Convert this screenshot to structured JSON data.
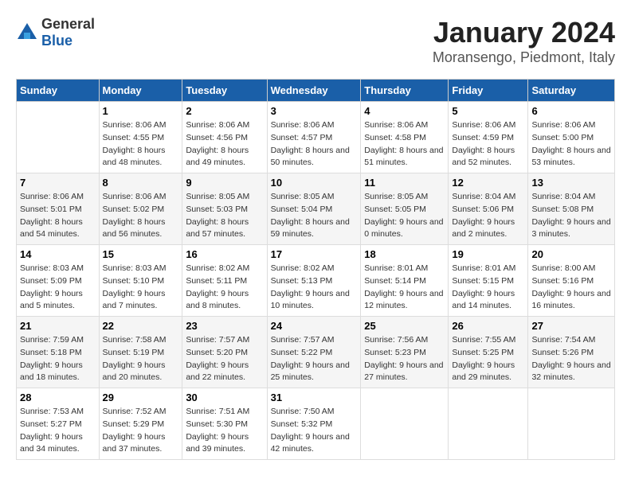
{
  "header": {
    "logo_general": "General",
    "logo_blue": "Blue",
    "title": "January 2024",
    "subtitle": "Moransengo, Piedmont, Italy"
  },
  "calendar": {
    "days_of_week": [
      "Sunday",
      "Monday",
      "Tuesday",
      "Wednesday",
      "Thursday",
      "Friday",
      "Saturday"
    ],
    "weeks": [
      [
        {
          "day": "",
          "sunrise": "",
          "sunset": "",
          "daylight": ""
        },
        {
          "day": "1",
          "sunrise": "Sunrise: 8:06 AM",
          "sunset": "Sunset: 4:55 PM",
          "daylight": "Daylight: 8 hours and 48 minutes."
        },
        {
          "day": "2",
          "sunrise": "Sunrise: 8:06 AM",
          "sunset": "Sunset: 4:56 PM",
          "daylight": "Daylight: 8 hours and 49 minutes."
        },
        {
          "day": "3",
          "sunrise": "Sunrise: 8:06 AM",
          "sunset": "Sunset: 4:57 PM",
          "daylight": "Daylight: 8 hours and 50 minutes."
        },
        {
          "day": "4",
          "sunrise": "Sunrise: 8:06 AM",
          "sunset": "Sunset: 4:58 PM",
          "daylight": "Daylight: 8 hours and 51 minutes."
        },
        {
          "day": "5",
          "sunrise": "Sunrise: 8:06 AM",
          "sunset": "Sunset: 4:59 PM",
          "daylight": "Daylight: 8 hours and 52 minutes."
        },
        {
          "day": "6",
          "sunrise": "Sunrise: 8:06 AM",
          "sunset": "Sunset: 5:00 PM",
          "daylight": "Daylight: 8 hours and 53 minutes."
        }
      ],
      [
        {
          "day": "7",
          "sunrise": "Sunrise: 8:06 AM",
          "sunset": "Sunset: 5:01 PM",
          "daylight": "Daylight: 8 hours and 54 minutes."
        },
        {
          "day": "8",
          "sunrise": "Sunrise: 8:06 AM",
          "sunset": "Sunset: 5:02 PM",
          "daylight": "Daylight: 8 hours and 56 minutes."
        },
        {
          "day": "9",
          "sunrise": "Sunrise: 8:05 AM",
          "sunset": "Sunset: 5:03 PM",
          "daylight": "Daylight: 8 hours and 57 minutes."
        },
        {
          "day": "10",
          "sunrise": "Sunrise: 8:05 AM",
          "sunset": "Sunset: 5:04 PM",
          "daylight": "Daylight: 8 hours and 59 minutes."
        },
        {
          "day": "11",
          "sunrise": "Sunrise: 8:05 AM",
          "sunset": "Sunset: 5:05 PM",
          "daylight": "Daylight: 9 hours and 0 minutes."
        },
        {
          "day": "12",
          "sunrise": "Sunrise: 8:04 AM",
          "sunset": "Sunset: 5:06 PM",
          "daylight": "Daylight: 9 hours and 2 minutes."
        },
        {
          "day": "13",
          "sunrise": "Sunrise: 8:04 AM",
          "sunset": "Sunset: 5:08 PM",
          "daylight": "Daylight: 9 hours and 3 minutes."
        }
      ],
      [
        {
          "day": "14",
          "sunrise": "Sunrise: 8:03 AM",
          "sunset": "Sunset: 5:09 PM",
          "daylight": "Daylight: 9 hours and 5 minutes."
        },
        {
          "day": "15",
          "sunrise": "Sunrise: 8:03 AM",
          "sunset": "Sunset: 5:10 PM",
          "daylight": "Daylight: 9 hours and 7 minutes."
        },
        {
          "day": "16",
          "sunrise": "Sunrise: 8:02 AM",
          "sunset": "Sunset: 5:11 PM",
          "daylight": "Daylight: 9 hours and 8 minutes."
        },
        {
          "day": "17",
          "sunrise": "Sunrise: 8:02 AM",
          "sunset": "Sunset: 5:13 PM",
          "daylight": "Daylight: 9 hours and 10 minutes."
        },
        {
          "day": "18",
          "sunrise": "Sunrise: 8:01 AM",
          "sunset": "Sunset: 5:14 PM",
          "daylight": "Daylight: 9 hours and 12 minutes."
        },
        {
          "day": "19",
          "sunrise": "Sunrise: 8:01 AM",
          "sunset": "Sunset: 5:15 PM",
          "daylight": "Daylight: 9 hours and 14 minutes."
        },
        {
          "day": "20",
          "sunrise": "Sunrise: 8:00 AM",
          "sunset": "Sunset: 5:16 PM",
          "daylight": "Daylight: 9 hours and 16 minutes."
        }
      ],
      [
        {
          "day": "21",
          "sunrise": "Sunrise: 7:59 AM",
          "sunset": "Sunset: 5:18 PM",
          "daylight": "Daylight: 9 hours and 18 minutes."
        },
        {
          "day": "22",
          "sunrise": "Sunrise: 7:58 AM",
          "sunset": "Sunset: 5:19 PM",
          "daylight": "Daylight: 9 hours and 20 minutes."
        },
        {
          "day": "23",
          "sunrise": "Sunrise: 7:57 AM",
          "sunset": "Sunset: 5:20 PM",
          "daylight": "Daylight: 9 hours and 22 minutes."
        },
        {
          "day": "24",
          "sunrise": "Sunrise: 7:57 AM",
          "sunset": "Sunset: 5:22 PM",
          "daylight": "Daylight: 9 hours and 25 minutes."
        },
        {
          "day": "25",
          "sunrise": "Sunrise: 7:56 AM",
          "sunset": "Sunset: 5:23 PM",
          "daylight": "Daylight: 9 hours and 27 minutes."
        },
        {
          "day": "26",
          "sunrise": "Sunrise: 7:55 AM",
          "sunset": "Sunset: 5:25 PM",
          "daylight": "Daylight: 9 hours and 29 minutes."
        },
        {
          "day": "27",
          "sunrise": "Sunrise: 7:54 AM",
          "sunset": "Sunset: 5:26 PM",
          "daylight": "Daylight: 9 hours and 32 minutes."
        }
      ],
      [
        {
          "day": "28",
          "sunrise": "Sunrise: 7:53 AM",
          "sunset": "Sunset: 5:27 PM",
          "daylight": "Daylight: 9 hours and 34 minutes."
        },
        {
          "day": "29",
          "sunrise": "Sunrise: 7:52 AM",
          "sunset": "Sunset: 5:29 PM",
          "daylight": "Daylight: 9 hours and 37 minutes."
        },
        {
          "day": "30",
          "sunrise": "Sunrise: 7:51 AM",
          "sunset": "Sunset: 5:30 PM",
          "daylight": "Daylight: 9 hours and 39 minutes."
        },
        {
          "day": "31",
          "sunrise": "Sunrise: 7:50 AM",
          "sunset": "Sunset: 5:32 PM",
          "daylight": "Daylight: 9 hours and 42 minutes."
        },
        {
          "day": "",
          "sunrise": "",
          "sunset": "",
          "daylight": ""
        },
        {
          "day": "",
          "sunrise": "",
          "sunset": "",
          "daylight": ""
        },
        {
          "day": "",
          "sunrise": "",
          "sunset": "",
          "daylight": ""
        }
      ]
    ]
  }
}
